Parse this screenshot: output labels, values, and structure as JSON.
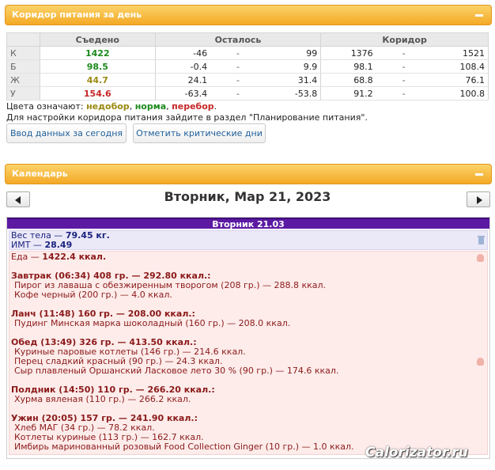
{
  "corridor_panel": {
    "title": "Коридор питания за день"
  },
  "table": {
    "headers": {
      "eaten": "Съедено",
      "left": "Осталось",
      "corridor": "Коридор"
    },
    "rows": [
      {
        "label": "К",
        "eaten": "1422",
        "left_min": "-46",
        "left_max": "99",
        "corr_min": "1376",
        "corr_max": "1521",
        "color": "#1c8a1c"
      },
      {
        "label": "Б",
        "eaten": "98.5",
        "left_min": "-0.4",
        "left_max": "9.9",
        "corr_min": "98.1",
        "corr_max": "108.4",
        "color": "#1c8a1c"
      },
      {
        "label": "Ж",
        "eaten": "44.7",
        "left_min": "24.1",
        "left_max": "31.4",
        "corr_min": "68.8",
        "corr_max": "76.1",
        "color": "#9a8a12"
      },
      {
        "label": "У",
        "eaten": "154.6",
        "left_min": "-63.4",
        "left_max": "-53.8",
        "corr_min": "91.2",
        "corr_max": "100.8",
        "color": "#c62828"
      }
    ],
    "dash": "-"
  },
  "legend": {
    "prefix": "Цвета означают:",
    "under": "недобор",
    "norm": "норма",
    "over": "перебор",
    "sep1": ",",
    "sep2": ",",
    "end": ".",
    "settings_note": "Для настройки коридора питания зайдите в раздел \"Планирование питания\"."
  },
  "buttons": {
    "input_today": "Ввод данных за сегодня",
    "critical_days": "Отметить критические дни"
  },
  "calendar_panel": {
    "title": "Календарь"
  },
  "calendar": {
    "date_title": "Вторник, Мар 21, 2023",
    "day_header": "Вторник 21.03"
  },
  "body": {
    "weight_label": "Вес тела —",
    "weight_value": "79.45 кг.",
    "bmi_label": "ИМТ —",
    "bmi_value": "28.49"
  },
  "food": {
    "total_label": "Еда —",
    "total_value": "1422.4 ккал.",
    "meals": [
      {
        "title": "Завтрак (06:34) 408 гр. — 292.80 ккал.:",
        "items": [
          "Пирог из лаваша с обезжиренным творогом (208 гр.) — 288.8 ккал.",
          "Кофе черный (200 гр.) — 4.0 ккал."
        ]
      },
      {
        "title": "Ланч (11:48) 160 гр. — 208.00 ккал.:",
        "items": [
          "Пудинг Минская марка шоколадный (160 гр.) — 208.0 ккал."
        ]
      },
      {
        "title": "Обед (13:49) 326 гр. — 413.50 ккал.:",
        "items": [
          "Куриные паровые котлеты (146 гр.) — 214.6 ккал.",
          "Перец сладкий красный (90 гр.) — 24.3 ккал.",
          "Сыр плавленый Оршанский Ласковое лето 30 % (90 гр.) — 174.6 ккал."
        ]
      },
      {
        "title": "Полдник (14:50) 110 гр. — 266.20 ккал.:",
        "items": [
          "Хурма вяленая (110 гр.) — 266.2 ккал."
        ]
      },
      {
        "title": "Ужин (20:05) 157 гр. — 241.90 ккал.:",
        "items": [
          "Хлеб МАГ (34 гр.) — 78.2 ккал.",
          "Котлеты куриные (113 гр.) — 162.7 ккал.",
          "Имбирь маринованный розовый Food Collection Ginger (10 гр.) — 1.0 ккал."
        ]
      }
    ]
  },
  "watermark": "Calorizator.ru"
}
